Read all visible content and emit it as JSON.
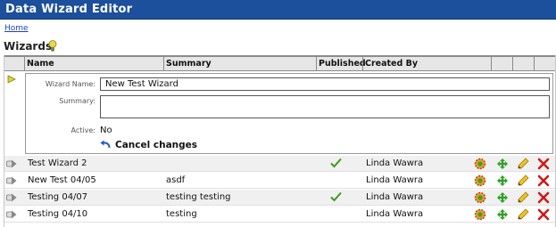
{
  "window": {
    "title": "Data Wizard Editor"
  },
  "nav": {
    "home_link": "Home"
  },
  "section": {
    "title": "Wizards"
  },
  "table": {
    "columns": [
      "Name",
      "Summary",
      "Published",
      "Created By"
    ]
  },
  "editor": {
    "name_label": "Wizard Name:",
    "name_value": "New Test Wizard",
    "summary_label": "Summary:",
    "summary_value": "",
    "active_label": "Active:",
    "active_value": "No",
    "cancel_label": "Cancel changes"
  },
  "rows": [
    {
      "name": "Test Wizard 2",
      "summary": "",
      "published": true,
      "created_by": "Linda Wawra"
    },
    {
      "name": "New Test 04/05",
      "summary": "asdf",
      "published": false,
      "created_by": "Linda Wawra"
    },
    {
      "name": "Testing 04/07",
      "summary": "testing testing",
      "published": true,
      "created_by": "Linda Wawra"
    },
    {
      "name": "Testing 04/10",
      "summary": "testing",
      "published": false,
      "created_by": "Linda Wawra"
    }
  ],
  "icons": {
    "go": "go-arrow-icon",
    "published": "check-icon",
    "settings": "gear-icon",
    "move": "move-arrows-icon",
    "edit": "pencil-icon",
    "delete": "delete-x-icon"
  },
  "colors": {
    "titlebar": "#1c4f9c",
    "link": "#1a46c8",
    "check": "#3d9a1e",
    "delete": "#d01818",
    "move": "#33a12a"
  }
}
